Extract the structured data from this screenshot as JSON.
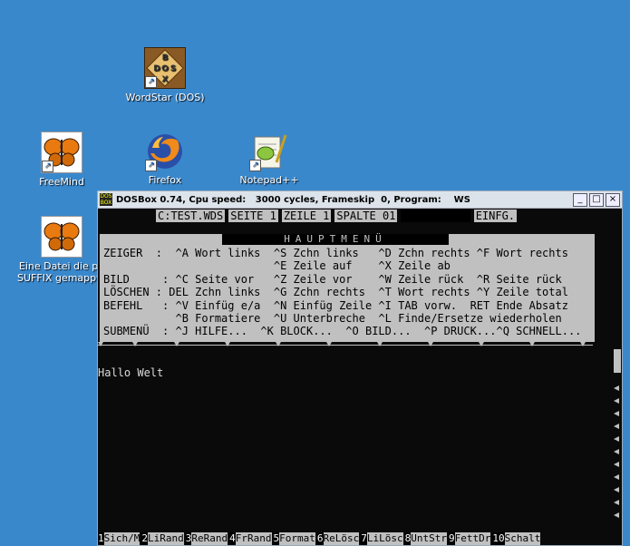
{
  "desktop": {
    "icons": [
      {
        "label": "WordStar (DOS)"
      },
      {
        "label": "FreeMind"
      },
      {
        "label": "Firefox"
      },
      {
        "label": "Notepad++"
      },
      {
        "label_line1": "Eine Datei die pe",
        "label_line2": "SUFFIX gemappt i"
      }
    ],
    "dos_logo_letters": [
      "D",
      "O",
      "S",
      "X",
      "B"
    ]
  },
  "window": {
    "title": "DOSBox 0.74, Cpu speed:   3000 cycles, Frameskip  0, Program:    WS",
    "app_icon_text": "DOS BOX"
  },
  "status": {
    "file": "C:TEST.WDS",
    "page": "SEITE 1",
    "line": "ZEILE 1",
    "column": "SPALTE 01",
    "mode": "EINFG."
  },
  "menu": {
    "title": "HAUPTMENÜ",
    "rows": [
      "ZEIGER  :  ^A Wort links  ^S Zchn links   ^D Zchn rechts ^F Wort rechts",
      "                          ^E Zeile auf    ^X Zeile ab",
      "BILD     : ^C Seite vor   ^Z Zeile vor    ^W Zeile rück  ^R Seite rück",
      "LÖSCHEN : DEL Zchn links  ^G Zchn rechts  ^T Wort rechts ^Y Zeile total",
      "BEFEHL   : ^V Einfüg e/a  ^N Einfüg Zeile ^I TAB vorw.  RET Ende Absatz",
      "           ^B Formatiere  ^U Unterbreche  ^L Finde/Ersetze wiederholen",
      "SUBMENÜ  : ^J HILFE...  ^K BLOCK...  ^O BILD...  ^P DRUCK...^Q SCHNELL..."
    ]
  },
  "document": {
    "text": "Hallo Welt"
  },
  "function_keys": [
    {
      "num": "1",
      "label": "Sich/M"
    },
    {
      "num": "2",
      "label": "LiRand"
    },
    {
      "num": "3",
      "label": "ReRand"
    },
    {
      "num": "4",
      "label": "FrRand"
    },
    {
      "num": "5",
      "label": "Format"
    },
    {
      "num": "6",
      "label": "ReLösc"
    },
    {
      "num": "7",
      "label": "LiLösc"
    },
    {
      "num": "8",
      "label": "UntStr"
    },
    {
      "num": "9",
      "label": "FettDr"
    },
    {
      "num": "10",
      "label": "Schalt"
    }
  ],
  "colors": {
    "desktop": "#3a88cc",
    "terminal_bg": "#0a0a0a",
    "terminal_fg": "#dcdcdc",
    "menu_bg": "#c0c0c0"
  }
}
